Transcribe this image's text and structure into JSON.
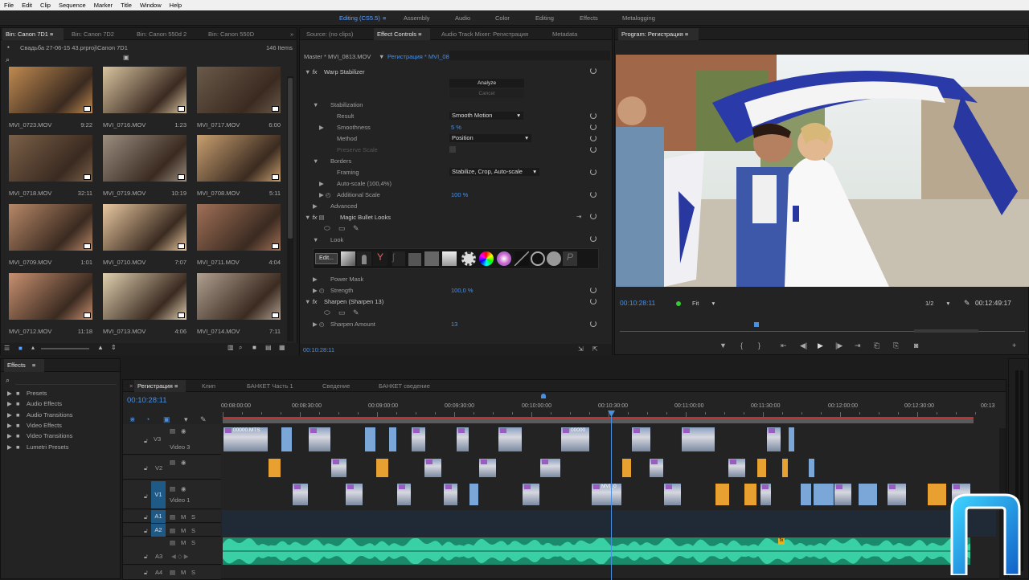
{
  "menu": [
    "File",
    "Edit",
    "Clip",
    "Sequence",
    "Marker",
    "Title",
    "Window",
    "Help"
  ],
  "workspaces": {
    "editing": "Editing (CS5.5)",
    "assembly": "Assembly",
    "audio": "Audio",
    "color": "Color",
    "editing2": "Editing",
    "effects": "Effects",
    "metalogging": "Metalogging"
  },
  "bin": {
    "tabs": [
      "Bin: Canon 7D1",
      "Bin: Canon 7D2",
      "Bin: Canon 550d 2",
      "Bin: Canon 550D"
    ],
    "path": "Свадьба 27-06-15 43.prproj\\Canon 7D1",
    "count": "146 Items",
    "items": [
      {
        "name": "MVI_0723.MOV",
        "dur": "9:22"
      },
      {
        "name": "MVI_0716.MOV",
        "dur": "1:23"
      },
      {
        "name": "MVI_0717.MOV",
        "dur": "6:00"
      },
      {
        "name": "MVI_0718.MOV",
        "dur": "32:11"
      },
      {
        "name": "MVI_0719.MOV",
        "dur": "10:19"
      },
      {
        "name": "MVI_0708.MOV",
        "dur": "5:11"
      },
      {
        "name": "MVI_0709.MOV",
        "dur": "1:01"
      },
      {
        "name": "MVI_0710.MOV",
        "dur": "7:07"
      },
      {
        "name": "MVI_0711.MOV",
        "dur": "4:04"
      },
      {
        "name": "MVI_0712.MOV",
        "dur": "11:18"
      },
      {
        "name": "MVI_0713.MOV",
        "dur": "4:06"
      },
      {
        "name": "MVI_0714.MOV",
        "dur": "7:11"
      }
    ],
    "colors": [
      "#c08a50",
      "#d8c4a0",
      "#6a5a4a",
      "#7a6048",
      "#9a8e80",
      "#c8a070",
      "#b88868",
      "#e8c8a0",
      "#a07058",
      "#c89070",
      "#e0d0b0",
      "#b0a090"
    ]
  },
  "ec": {
    "tabs": [
      "Source: (no clips)",
      "Effect Controls",
      "Audio Track Mixer: Регистрация",
      "Metadata"
    ],
    "master": "Master * MVI_0813.MOV",
    "seq": "Регистрация * MVI_0813.MOV",
    "warp": "Warp Stabilizer",
    "analyze": "Analyze",
    "cancel": "Cancel",
    "stabilization": "Stabilization",
    "result": "Result",
    "result_val": "Smooth Motion",
    "smoothness": "Smoothness",
    "smoothness_val": "5 %",
    "method": "Method",
    "method_val": "Position",
    "preserve": "Preserve Scale",
    "borders": "Borders",
    "framing": "Framing",
    "framing_val": "Stabilize, Crop, Auto-scale",
    "autoscale": "Auto-scale (100,4%)",
    "addscale": "Additional Scale",
    "addscale_val": "100 %",
    "advanced": "Advanced",
    "mbl": "Magic Bullet Looks",
    "look": "Look",
    "edit": "Edit...",
    "powermask": "Power Mask",
    "strength": "Strength",
    "strength_val": "100,0 %",
    "sharpen": "Sharpen (Sharpen 13)",
    "sharpamt": "Sharpen Amount",
    "sharpamt_val": "13",
    "time": "00:10:28:11"
  },
  "program": {
    "title": "Program: Регистрация",
    "time": "00:10:28:11",
    "fit": "Fit",
    "res": "1/2",
    "dur": "00:12:49:17"
  },
  "effects": {
    "title": "Effects",
    "items": [
      "Presets",
      "Audio Effects",
      "Audio Transitions",
      "Video Effects",
      "Video Transitions",
      "Lumetri Presets"
    ]
  },
  "timeline": {
    "tabs": [
      "Регистрация",
      "Клип",
      "БАНКЕТ Часть 1",
      "Сведение",
      "БАНКЕТ сведение"
    ],
    "time": "00:10:28:11",
    "ruler": [
      "00:08:00:00",
      "00:08:30:00",
      "00:09:00:00",
      "00:09:30:00",
      "00:10:00:00",
      "00:10:30:00",
      "00:11:00:00",
      "00:11:30:00",
      "00:12:00:00",
      "00:12:30:00",
      "00:13"
    ],
    "tracks": {
      "v3": "V3",
      "v3name": "Video 3",
      "v2": "V2",
      "v1": "V1",
      "v1name": "Video 1",
      "a1": "A1",
      "a2": "A2",
      "a3": "A3",
      "a4": "A4",
      "m": "M",
      "s": "S"
    },
    "clip_labels": [
      "00000.MTS",
      "00000",
      "MVI_0"
    ]
  }
}
